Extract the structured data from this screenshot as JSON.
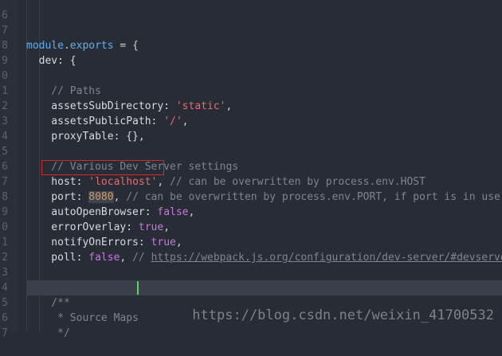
{
  "editor": {
    "lines": [
      {
        "num": "6",
        "text": ""
      },
      {
        "num": "7",
        "text": "module.exports = {"
      },
      {
        "num": "8",
        "text": "  dev: {"
      },
      {
        "num": "9",
        "text": ""
      },
      {
        "num": "0",
        "text": "    // Paths"
      },
      {
        "num": "1",
        "text": "    assetsSubDirectory: 'static',"
      },
      {
        "num": "2",
        "text": "    assetsPublicPath: '/',"
      },
      {
        "num": "3",
        "text": "    proxyTable: {},"
      },
      {
        "num": "4",
        "text": ""
      },
      {
        "num": "5",
        "text": "    // Various Dev Server settings"
      },
      {
        "num": "6",
        "text": "    host: 'localhost', // can be overwritten by process.env.HOST"
      },
      {
        "num": "7",
        "text": "    port: 8080, // can be overwritten by process.env.PORT, if port is in use,"
      },
      {
        "num": "8",
        "text": "    autoOpenBrowser: false,"
      },
      {
        "num": "9",
        "text": "    errorOverlay: true,"
      },
      {
        "num": "0",
        "text": "    notifyOnErrors: true,"
      },
      {
        "num": "1",
        "text": "    poll: false, // https://webpack.js.org/configuration/dev-server/#devserver"
      },
      {
        "num": "2",
        "text": ""
      },
      {
        "num": "3",
        "text": ""
      },
      {
        "num": "4",
        "text": "    /**"
      },
      {
        "num": "5",
        "text": "     * Source Maps"
      },
      {
        "num": "6",
        "text": "     */"
      },
      {
        "num": "7",
        "text": ""
      }
    ]
  },
  "watermark": "https://blog.csdn.net/weixin_41700532",
  "colors": {
    "background": "#282c34",
    "highlight_box": "#d02a2a",
    "cursor": "#5fd068"
  }
}
